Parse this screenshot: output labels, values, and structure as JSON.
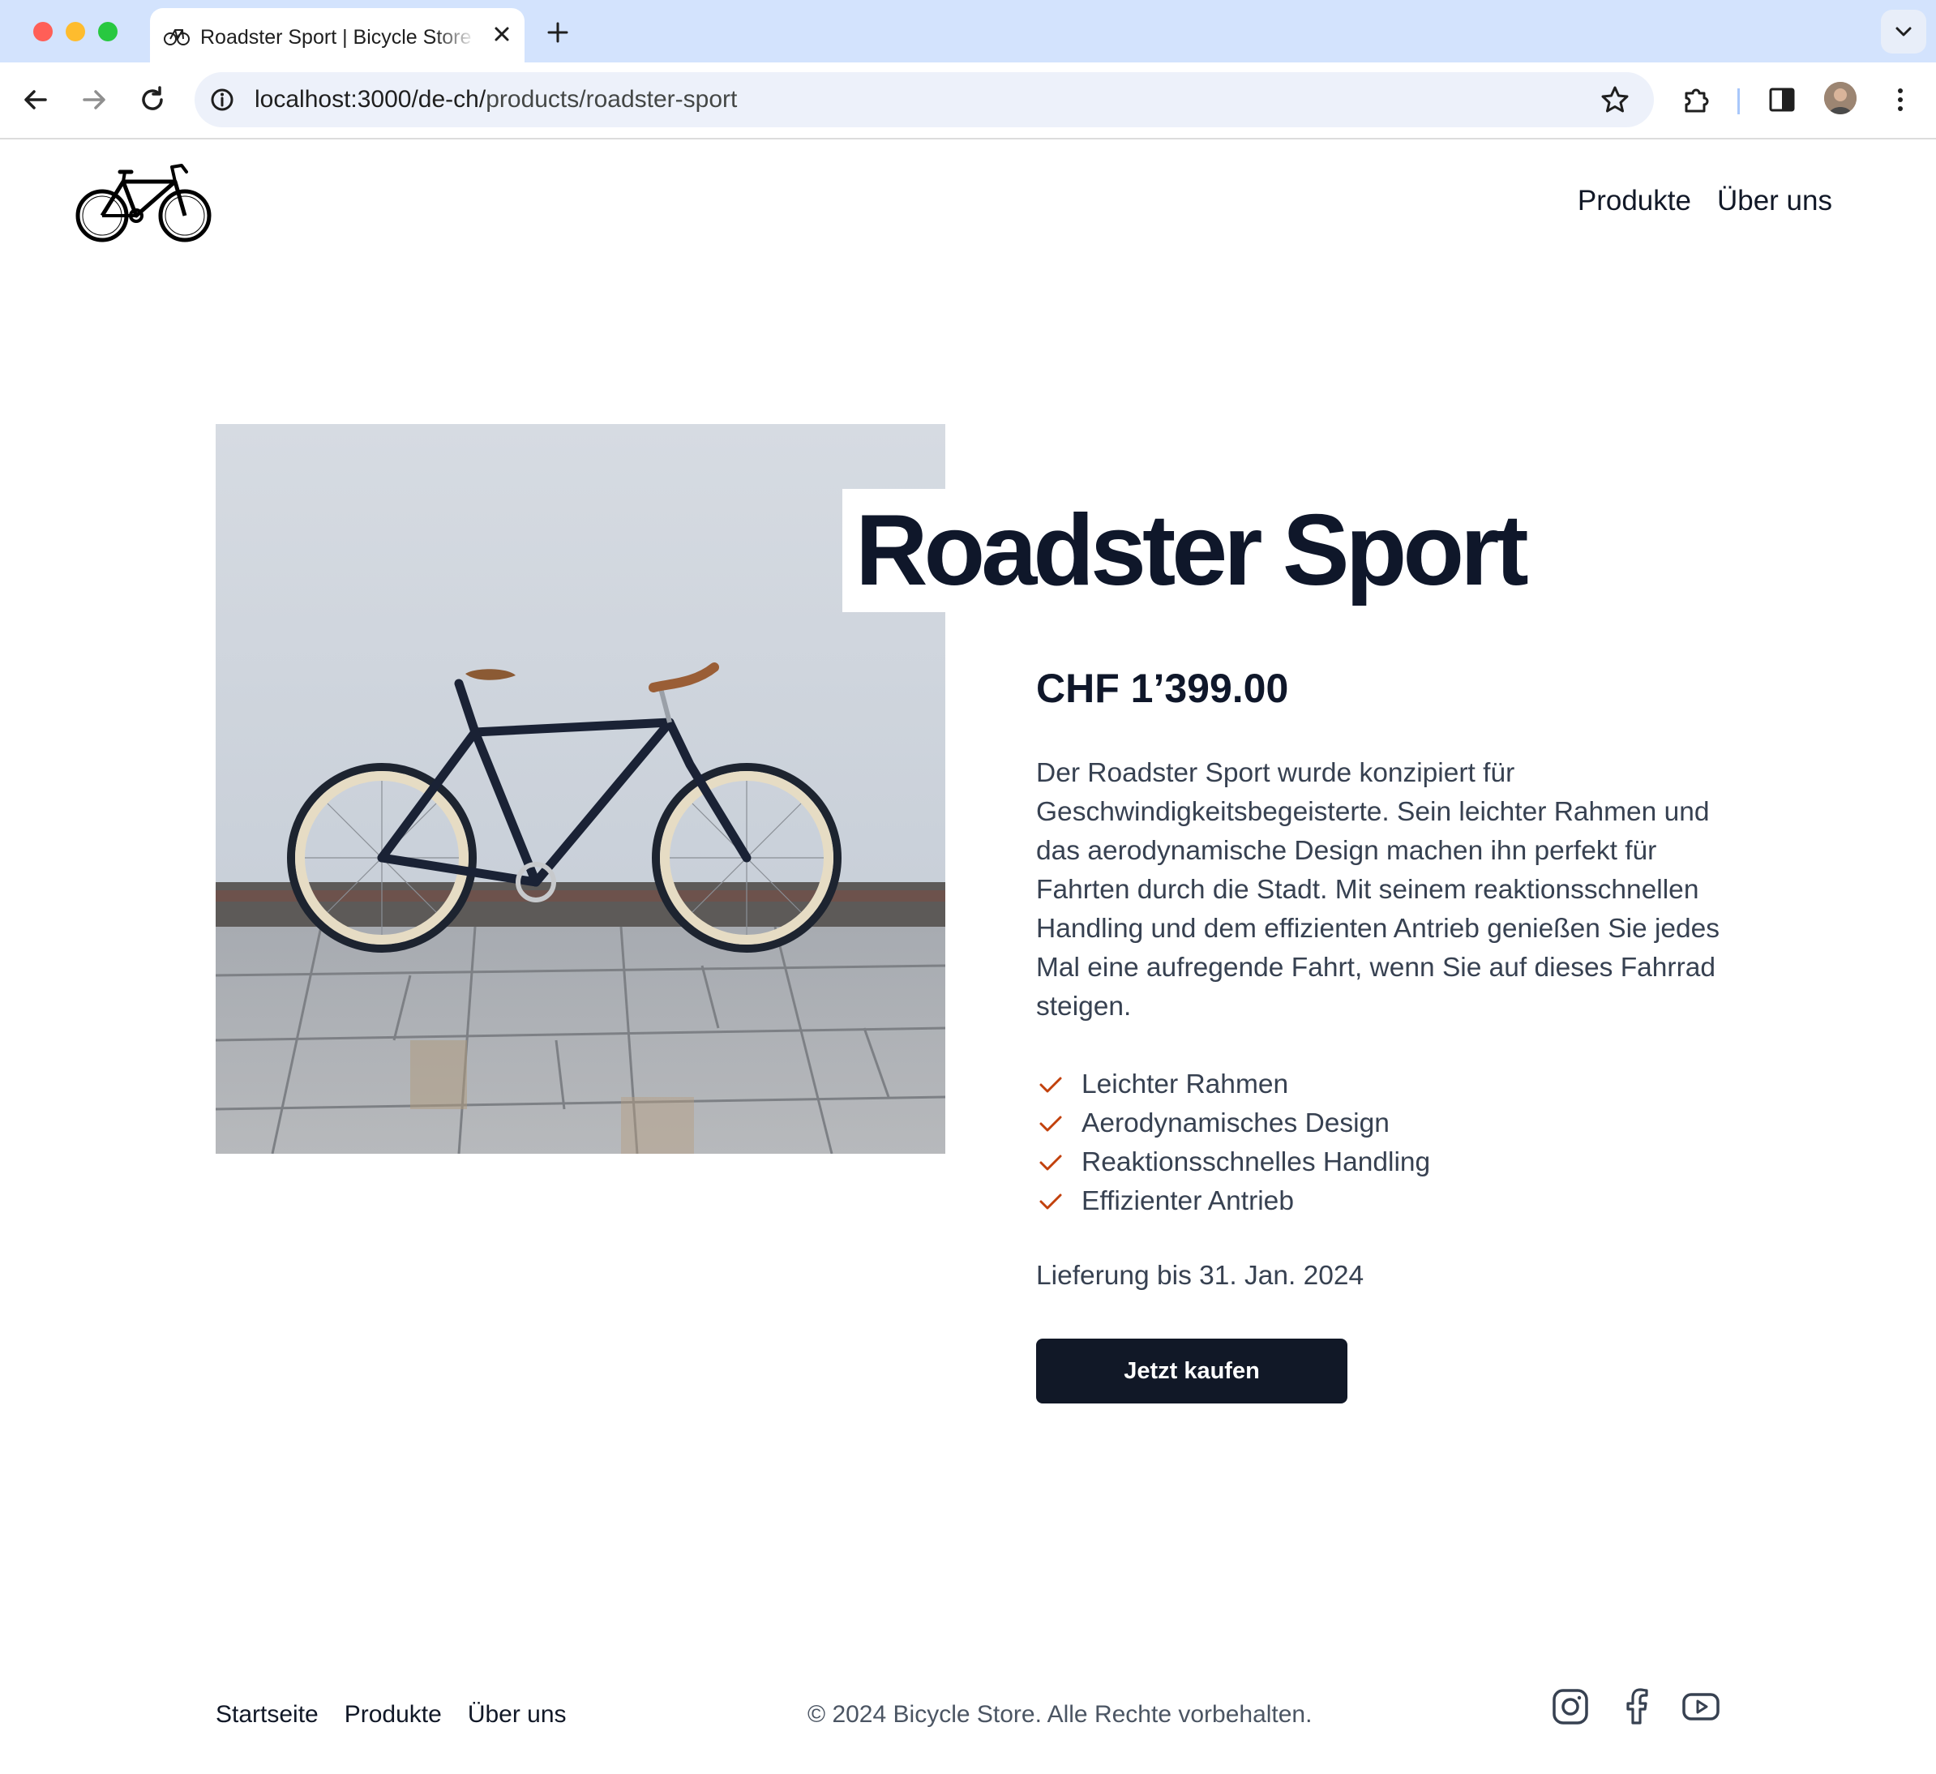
{
  "browser": {
    "tab_title": "Roadster Sport | Bicycle Store",
    "url_host": "localhost:3000/de-ch/",
    "url_path": "products/roadster-sport"
  },
  "site": {
    "nav": [
      "Produkte",
      "Über uns"
    ]
  },
  "product": {
    "title": "Roadster Sport",
    "price": "CHF 1’399.00",
    "description": "Der Roadster Sport wurde konzipiert für Geschwindigkeitsbegeisterte. Sein leichter Rahmen und das aerodynamische Design machen ihn perfekt für Fahrten durch die Stadt. Mit seinem reaktionsschnellen Handling und dem effizienten Antrieb genießen Sie jedes Mal eine aufregende Fahrt, wenn Sie auf dieses Fahrrad steigen.",
    "features": [
      "Leichter Rahmen",
      "Aerodynamisches Design",
      "Reaktionsschnelles Handling",
      "Effizienter Antrieb"
    ],
    "delivery": "Lieferung bis 31. Jan. 2024",
    "buy_label": "Jetzt kaufen"
  },
  "footer": {
    "links": [
      "Startseite",
      "Produkte",
      "Über uns"
    ],
    "copyright": "© 2024 Bicycle Store. Alle Rechte vorbehalten.",
    "social_icons": [
      "instagram-icon",
      "facebook-icon",
      "youtube-icon"
    ]
  },
  "colors": {
    "primary": "#111827",
    "check_accent": "#c2410c",
    "tabstrip": "#d3e3fd"
  }
}
